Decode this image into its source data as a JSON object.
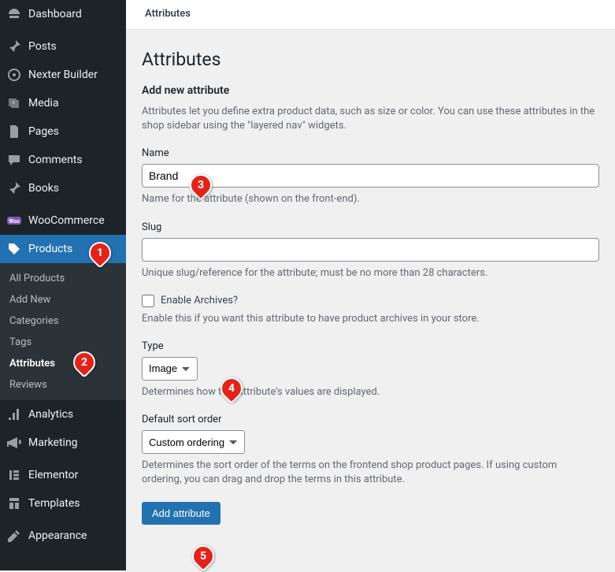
{
  "sidebar": {
    "dashboard": "Dashboard",
    "posts": "Posts",
    "nexter": "Nexter Builder",
    "media": "Media",
    "pages": "Pages",
    "comments": "Comments",
    "books": "Books",
    "woocommerce": "WooCommerce",
    "products": "Products",
    "submenu": {
      "all_products": "All Products",
      "add_new": "Add New",
      "categories": "Categories",
      "tags": "Tags",
      "attributes": "Attributes",
      "reviews": "Reviews"
    },
    "analytics": "Analytics",
    "marketing": "Marketing",
    "elementor": "Elementor",
    "templates": "Templates",
    "appearance": "Appearance"
  },
  "topbar": {
    "title": "Attributes"
  },
  "page": {
    "title": "Attributes",
    "section_title": "Add new attribute",
    "intro": "Attributes let you define extra product data, such as size or color. You can use these attributes in the shop sidebar using the \"layered nav\" widgets.",
    "name_label": "Name",
    "name_value": "Brand",
    "name_help": "Name for the attribute (shown on the front-end).",
    "slug_label": "Slug",
    "slug_value": "",
    "slug_help": "Unique slug/reference for the attribute; must be no more than 28 characters.",
    "archives_label": "Enable Archives?",
    "archives_help": "Enable this if you want this attribute to have product archives in your store.",
    "type_label": "Type",
    "type_value": "Image",
    "type_help": "Determines how this attribute's values are displayed.",
    "sort_label": "Default sort order",
    "sort_value": "Custom ordering",
    "sort_help": "Determines the sort order of the terms on the frontend shop product pages. If using custom ordering, you can drag and drop the terms in this attribute.",
    "submit": "Add attribute"
  },
  "markers": {
    "m1": "1",
    "m2": "2",
    "m3": "3",
    "m4": "4",
    "m5": "5"
  }
}
